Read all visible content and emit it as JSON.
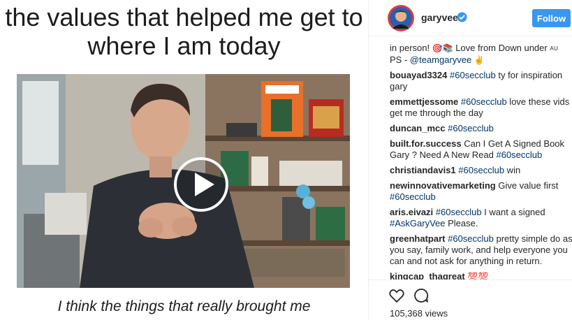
{
  "post": {
    "caption_top": "the values that helped me get to where I am today",
    "caption_bottom": "I think the things that really brought me"
  },
  "header": {
    "username": "garyvee",
    "follow_label": "Follow"
  },
  "comments": [
    {
      "user": "",
      "pre": "in person! ",
      "emoji1": "🎯📚",
      "mid": " Love from Down under ",
      "flag": "AU",
      "line2": "PS - ",
      "mention": "@teamgaryvee",
      "emoji2": "✌"
    },
    {
      "user": "bouayad3324",
      "tag": "#60secclub",
      "text": " ty for inspiration gary"
    },
    {
      "user": "emmettjessome",
      "tag": "#60secclub",
      "text": " love these vids get me through the day"
    },
    {
      "user": "duncan_mcc",
      "tag": "#60secclub",
      "text": ""
    },
    {
      "user": "built.for.success",
      "pre": " Can I Get A Signed Book Gary ? Need A New Read ",
      "tag": "#60secclub"
    },
    {
      "user": "christiandavis1",
      "tag": "#60secclub",
      "text": " win"
    },
    {
      "user": "newinnovativemarketing",
      "pre": " Give value first ",
      "tag": "#60secclub"
    },
    {
      "user": "aris.eivazi",
      "tag": "#60secclub",
      "text": " I want a signed ",
      "tag2": "#AskGaryVee",
      "text2": " Please."
    },
    {
      "user": "greenhatpart",
      "tag": "#60secclub",
      "text": " pretty simple do as you say, family work, and help everyone you can and not ask for anything in return."
    },
    {
      "user": "kingcap_thagreat",
      "emoji": "💯💯"
    }
  ],
  "stats": {
    "views": "105,368 views"
  },
  "colors": {
    "follow_blue": "#3897f0",
    "hashtag": "#003569",
    "verified": "#3897f0"
  }
}
